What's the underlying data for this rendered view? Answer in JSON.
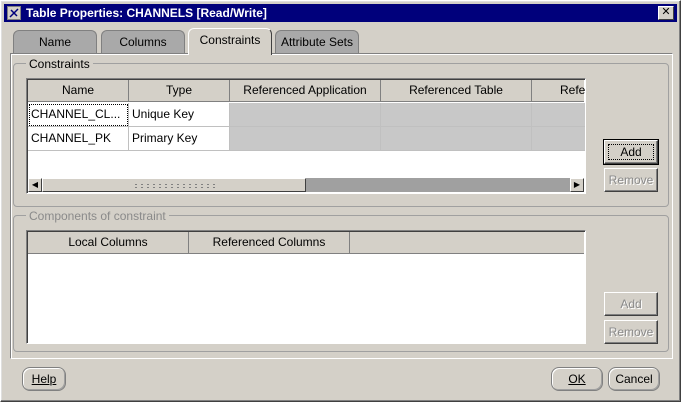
{
  "window": {
    "title": "Table Properties: CHANNELS [Read/Write]",
    "close_glyph": "✕"
  },
  "tabs": [
    {
      "label": "Name",
      "active": false
    },
    {
      "label": "Columns",
      "active": false
    },
    {
      "label": "Constraints",
      "active": true
    },
    {
      "label": "Attribute Sets",
      "active": false
    }
  ],
  "constraints_group": {
    "label": "Constraints",
    "columns": [
      "Name",
      "Type",
      "Referenced Application",
      "Referenced Table",
      "Refe"
    ],
    "rows": [
      [
        "CHANNEL_CL...",
        "Unique Key",
        "",
        "",
        ""
      ],
      [
        "CHANNEL_PK",
        "Primary Key",
        "",
        "",
        ""
      ]
    ],
    "add_label": "Add",
    "remove_label": "Remove"
  },
  "components_group": {
    "label": "Components of constraint",
    "columns": [
      "Local Columns",
      "Referenced Columns"
    ],
    "add_label": "Add",
    "remove_label": "Remove"
  },
  "footer": {
    "help_label": "Help",
    "ok_label": "OK",
    "cancel_label": "Cancel"
  },
  "icons": {
    "app": "oracle-app-icon",
    "scroll_left": "◀",
    "scroll_right": "▶"
  }
}
